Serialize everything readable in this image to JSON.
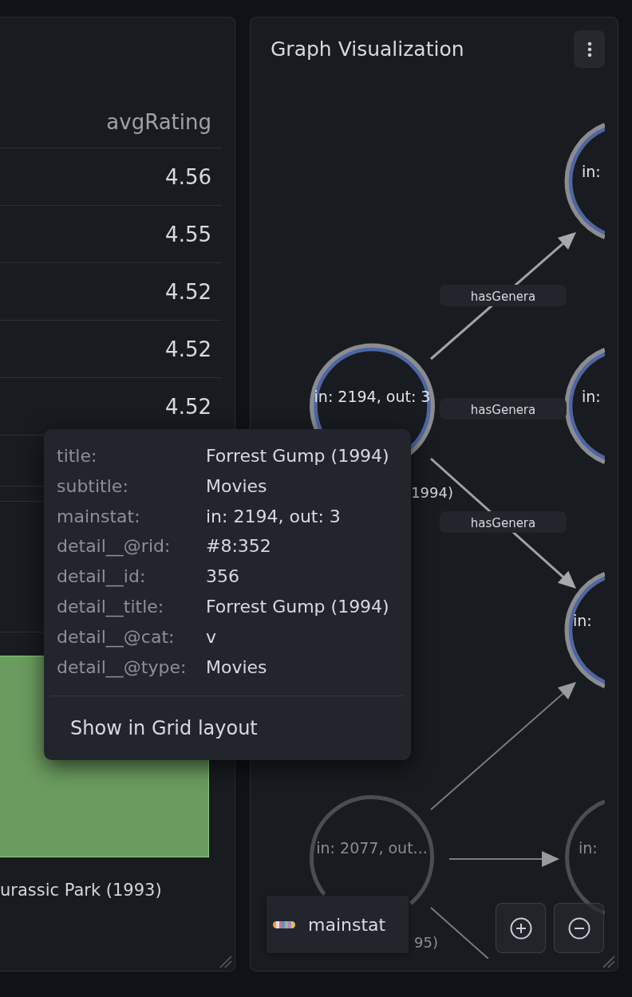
{
  "table": {
    "columns": [
      "avgRating"
    ],
    "rows": [
      [
        "4.56"
      ],
      [
        "4.55"
      ],
      [
        "4.52"
      ],
      [
        "4.52"
      ],
      [
        "4.52"
      ]
    ]
  },
  "bar_chart": {
    "bars": [
      {
        "label": "urassic Park (1993)"
      }
    ]
  },
  "graph_panel": {
    "title": "Graph Visualization",
    "nodes": [
      {
        "mainstat": "in:",
        "highlighted": true
      },
      {
        "mainstat": "in: 2194, out: 3",
        "title": "1994)",
        "highlighted": true
      },
      {
        "mainstat": "in:",
        "highlighted": true
      },
      {
        "mainstat": "in:",
        "highlighted": true
      },
      {
        "mainstat": "in: 2077, out...",
        "title": "95)",
        "highlighted": false
      },
      {
        "mainstat": "in:",
        "highlighted": false
      }
    ],
    "edges": [
      {
        "label": "hasGenera",
        "highlighted": true
      },
      {
        "label": "hasGenera",
        "highlighted": true
      },
      {
        "label": "hasGenera",
        "highlighted": true
      },
      {
        "highlighted": false
      },
      {
        "highlighted": false
      },
      {
        "highlighted": false
      }
    ],
    "legend": [
      {
        "label": "mainstat"
      }
    ]
  },
  "tooltip": {
    "fields": [
      {
        "label": "title:",
        "value": "Forrest Gump (1994)"
      },
      {
        "label": "subtitle:",
        "value": "Movies"
      },
      {
        "label": "mainstat:",
        "value": "in: 2194, out: 3"
      },
      {
        "label": "detail__@rid:",
        "value": "#8:352"
      },
      {
        "label": "detail__id:",
        "value": "356"
      },
      {
        "label": "detail__title:",
        "value": "Forrest Gump (1994)"
      },
      {
        "label": "detail__@cat:",
        "value": "v"
      },
      {
        "label": "detail__@type:",
        "value": "Movies"
      }
    ],
    "actions": [
      "Show in Grid layout"
    ]
  }
}
